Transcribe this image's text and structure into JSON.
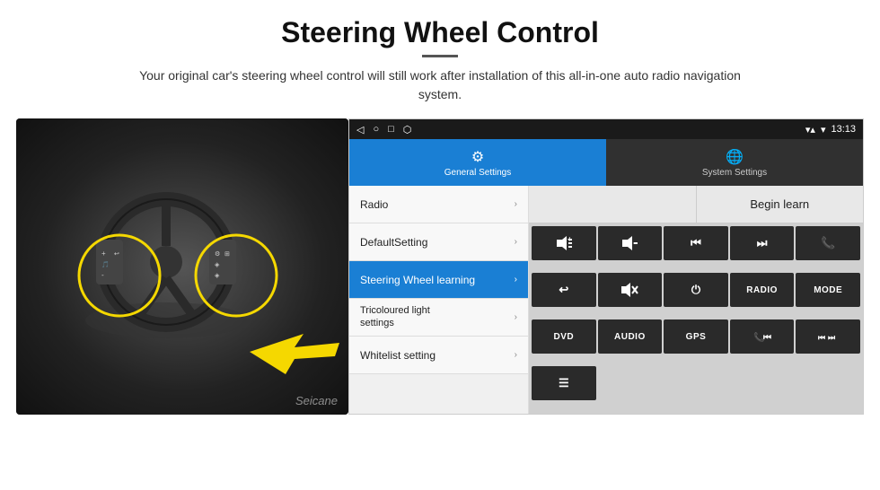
{
  "header": {
    "title": "Steering Wheel Control",
    "subtitle": "Your original car's steering wheel control will still work after installation of this all-in-one auto radio navigation system."
  },
  "statusBar": {
    "time": "13:13",
    "icons": [
      "◁",
      "○",
      "□",
      "⬡"
    ]
  },
  "tabs": [
    {
      "label": "General Settings",
      "icon": "⚙",
      "active": true
    },
    {
      "label": "System Settings",
      "icon": "🌐",
      "active": false
    }
  ],
  "menuItems": [
    {
      "label": "Radio",
      "active": false
    },
    {
      "label": "DefaultSetting",
      "active": false
    },
    {
      "label": "Steering Wheel learning",
      "active": true
    },
    {
      "label": "Tricoloured light settings",
      "active": false
    },
    {
      "label": "Whitelist setting",
      "active": false
    }
  ],
  "controls": {
    "beginLearnLabel": "Begin learn",
    "buttons": [
      {
        "label": "🔊+",
        "row": 1
      },
      {
        "label": "🔊-",
        "row": 1
      },
      {
        "label": "⏮",
        "row": 1
      },
      {
        "label": "⏭",
        "row": 1
      },
      {
        "label": "📞",
        "row": 1
      },
      {
        "label": "↩",
        "row": 2
      },
      {
        "label": "🔇",
        "row": 2
      },
      {
        "label": "⏻",
        "row": 2
      },
      {
        "label": "RADIO",
        "row": 2,
        "text": true
      },
      {
        "label": "MODE",
        "row": 2,
        "text": true
      },
      {
        "label": "DVD",
        "row": 3,
        "text": true
      },
      {
        "label": "AUDIO",
        "row": 3,
        "text": true
      },
      {
        "label": "GPS",
        "row": 3,
        "text": true
      },
      {
        "label": "📞⏮",
        "row": 3
      },
      {
        "label": "⏮⏭",
        "row": 3
      },
      {
        "label": "☰",
        "row": 4
      }
    ]
  },
  "watermark": "Seicane"
}
